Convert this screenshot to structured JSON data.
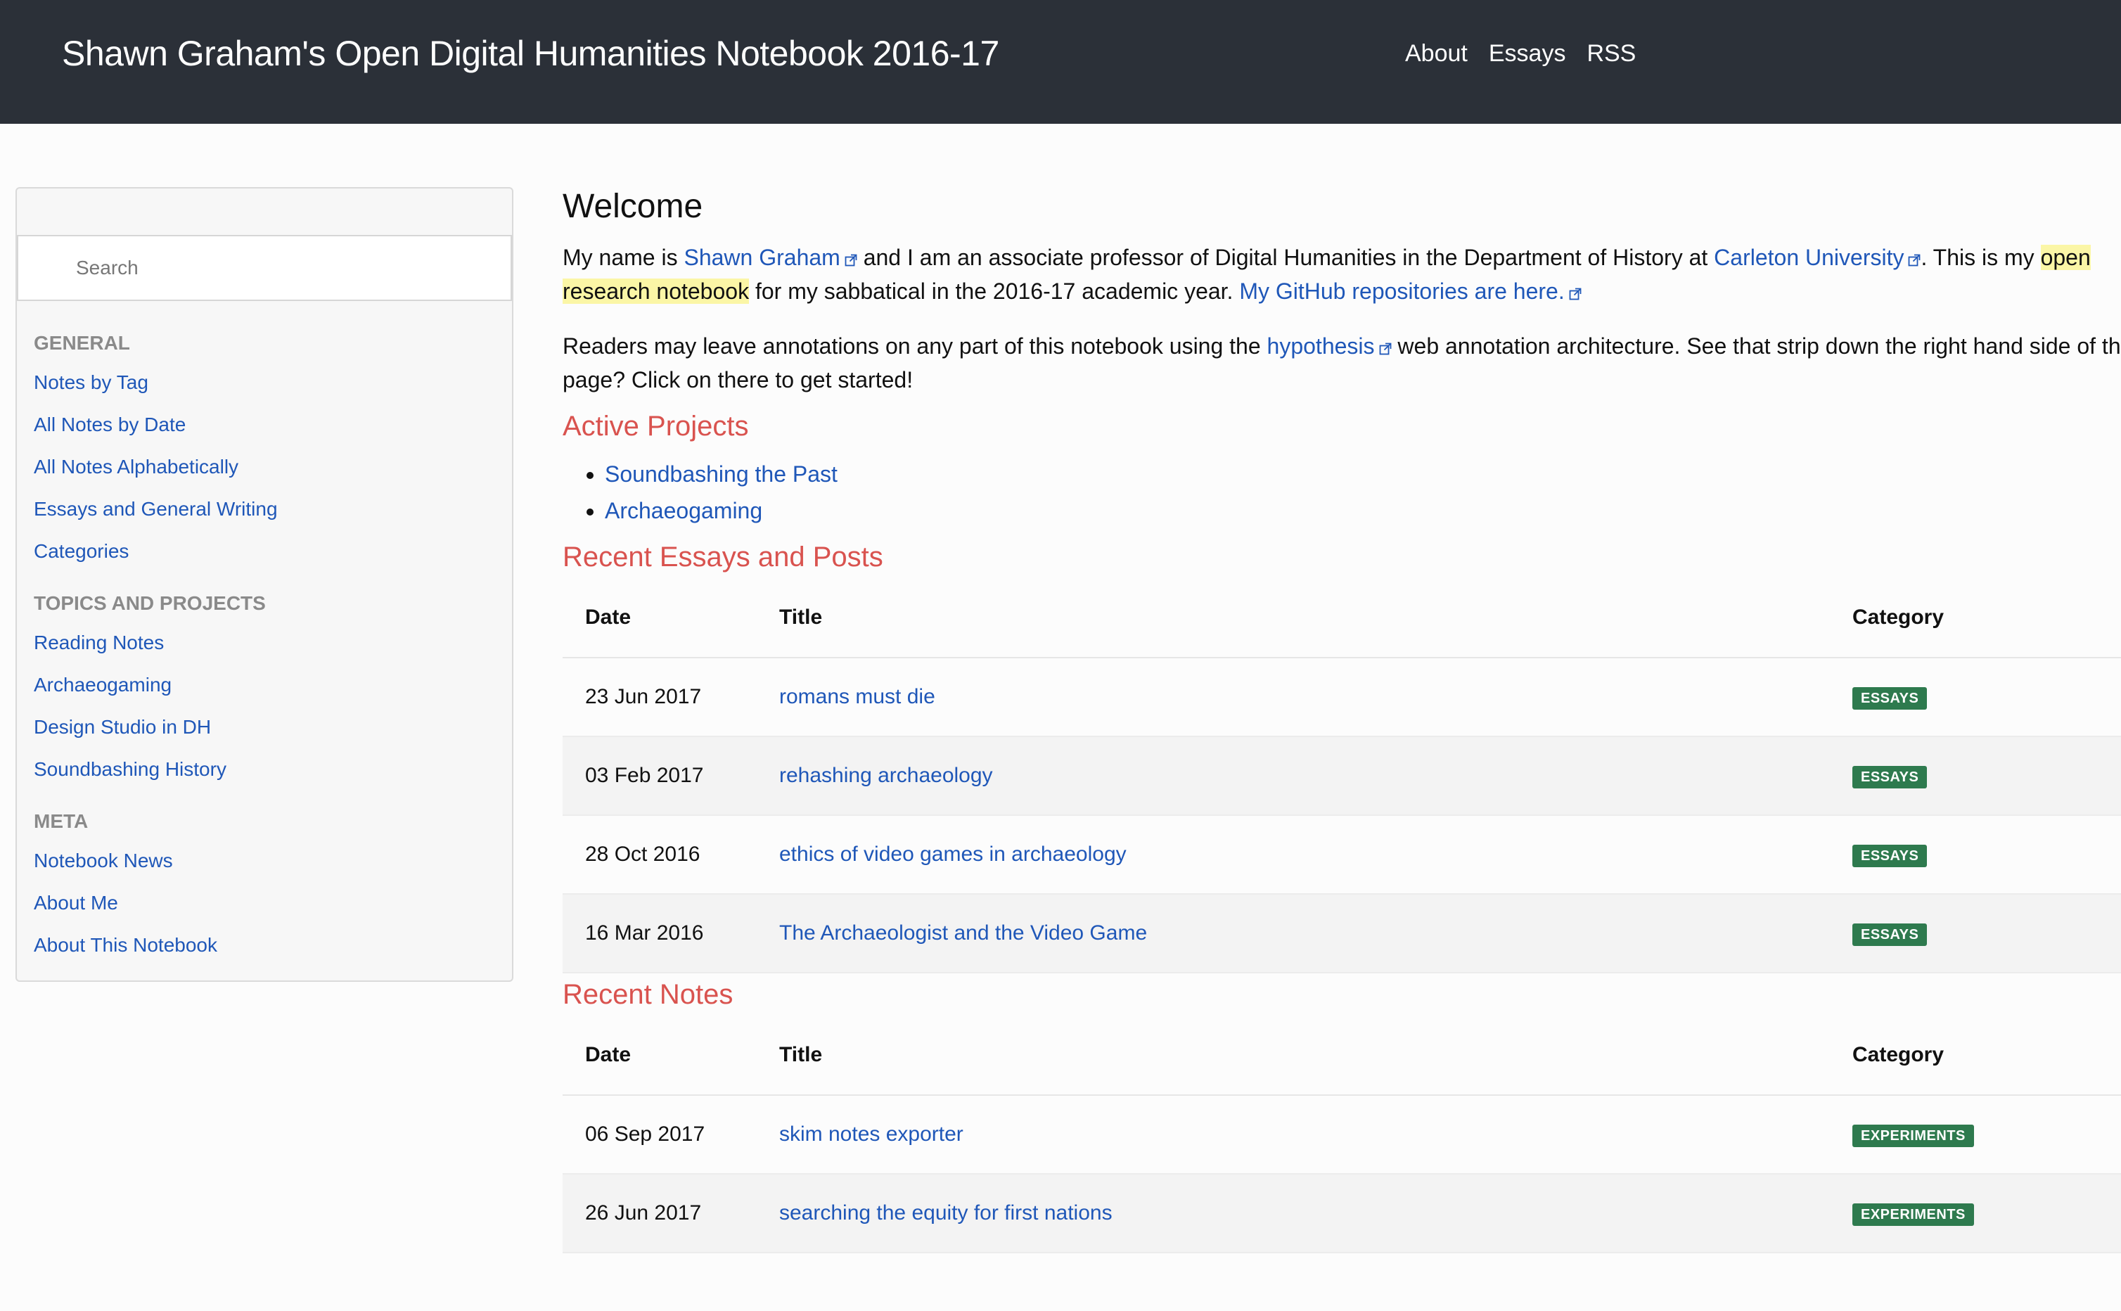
{
  "navbar": {
    "brand": "Shawn Graham's Open Digital Humanities Notebook 2016-17",
    "links": [
      "About",
      "Essays",
      "RSS"
    ]
  },
  "sidebar": {
    "search_placeholder": "Search",
    "sections": [
      {
        "header": "GENERAL",
        "items": [
          "Notes by Tag",
          "All Notes by Date",
          "All Notes Alphabetically",
          "Essays and General Writing",
          "Categories"
        ]
      },
      {
        "header": "TOPICS AND PROJECTS",
        "items": [
          "Reading Notes",
          "Archaeogaming",
          "Design Studio in DH",
          "Soundbashing History"
        ]
      },
      {
        "header": "META",
        "items": [
          "Notebook News",
          "About Me",
          "About This Notebook"
        ]
      }
    ]
  },
  "main": {
    "welcome_title": "Welcome",
    "intro": {
      "p1_t1": "My name is ",
      "p1_link1": "Shawn Graham",
      "p1_t2": " and I am an associate professor of Digital Humanities in the Department of History at ",
      "p1_link2": "Carleton University",
      "p1_t3": ". This is my ",
      "p1_hl1": "open",
      "p1_hl2": "research notebook",
      "p1_t4": " for my sabbatical in the 2016-17 academic year. ",
      "p1_link3": "My GitHub repositories are here.",
      "p2_t1": "Readers may leave annotations on any part of this notebook using the ",
      "p2_link": "hypothesis",
      "p2_t2": " web annotation architecture. See that strip down the right hand side of th",
      "p2_t3": "page? Click on there to get started!"
    },
    "active_projects_title": "Active Projects",
    "active_projects": [
      "Soundbashing the Past",
      "Archaeogaming"
    ],
    "recent_essays_title": "Recent Essays and Posts",
    "recent_notes_title": "Recent Notes",
    "table_headers": {
      "date": "Date",
      "title": "Title",
      "category": "Category"
    },
    "essays": [
      {
        "date": "23 Jun 2017",
        "title": "romans must die",
        "category": "ESSAYS"
      },
      {
        "date": "03 Feb 2017",
        "title": "rehashing archaeology",
        "category": "ESSAYS"
      },
      {
        "date": "28 Oct 2016",
        "title": "ethics of video games in archaeology",
        "category": "ESSAYS"
      },
      {
        "date": "16 Mar 2016",
        "title": "The Archaeologist and the Video Game",
        "category": "ESSAYS"
      }
    ],
    "notes": [
      {
        "date": "06 Sep 2017",
        "title": "skim notes exporter",
        "category": "EXPERIMENTS"
      },
      {
        "date": "26 Jun 2017",
        "title": "searching the equity for first nations",
        "category": "EXPERIMENTS"
      }
    ]
  },
  "colors": {
    "navbar_bg": "#2b3038",
    "link": "#1f57b8",
    "section_heading": "#d9534f",
    "badge_bg": "#2e7a4e",
    "highlight": "#fbf6a6"
  }
}
